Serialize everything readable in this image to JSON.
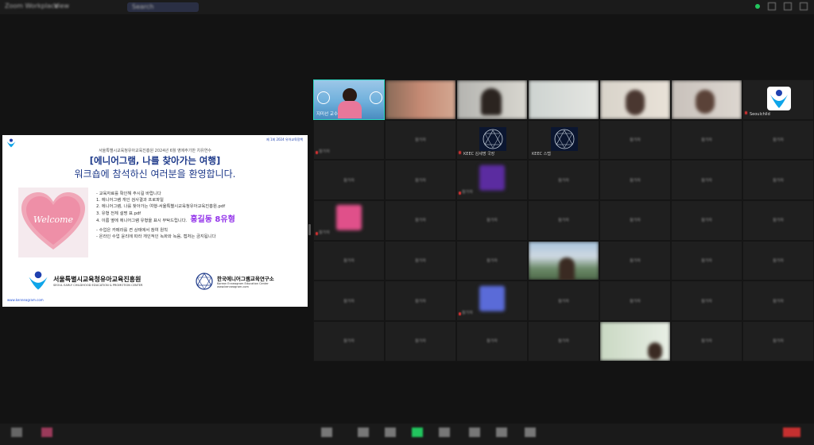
{
  "topbar": {
    "left_label": "Zoom Workplace",
    "view_label": "View",
    "search_placeholder": "Search"
  },
  "slide": {
    "topright_text": "제 1회 2024 유아교육정책",
    "subtitle": "서울특별시교육청유아교육진흥원 2024년 6월 영에주기반 치유연수",
    "title_line1": "[에니어그램, 나를 찾아가는 여행]",
    "title_line2": "워크숍에 참석하신 여러분을 환영합니다.",
    "welcome_text": "Welcome",
    "bullets": [
      "- 교육자료를 확인해 주시길 바랍니다",
      "1. 에니어그램 개인 검사결과 프로파일",
      "2. 에니어그램, 나를 찾아가는 여행-서울특별시교육청유아교육진흥원.pdf",
      "3. 유형 전체 설명 표.pdf",
      "4. 이름 옆에 에니어그램 유형을 표시 부탁드립니다.",
      "- 수업은 카메라를 켠 상태에서 참여 원칙",
      "- 온라인 수업 윤리에 따라 개인적인 녹화와 녹음, 캡처는 금지됩니다"
    ],
    "highlight_name": "홍길동",
    "highlight_num": "8",
    "highlight_suffix": "유형",
    "org1_name": "서울특별시교육청유아교육진흥원",
    "org1_sub": "SEOUL EARLY CHILDHOOD EDUCATION & PROMOTION CENTER",
    "org2_name": "한국에니어그램교육연구소",
    "org2_sub1": "Korean Enneagram Education Center",
    "org2_sub2": "www.kenneagram.com",
    "url": "www.kenneagram.com"
  },
  "participants": {
    "host_name": "지미선 교수",
    "seoulchild": "Seoulchild",
    "keec1": "KEEC 김세명 국장",
    "keec2": "KEEC 스텝",
    "blurred": "참가자"
  },
  "colors": {
    "background": "#131313",
    "active_speaker": "#2dd4bf",
    "slide_title": "#1e3a8a",
    "highlight": "#9333ea"
  }
}
